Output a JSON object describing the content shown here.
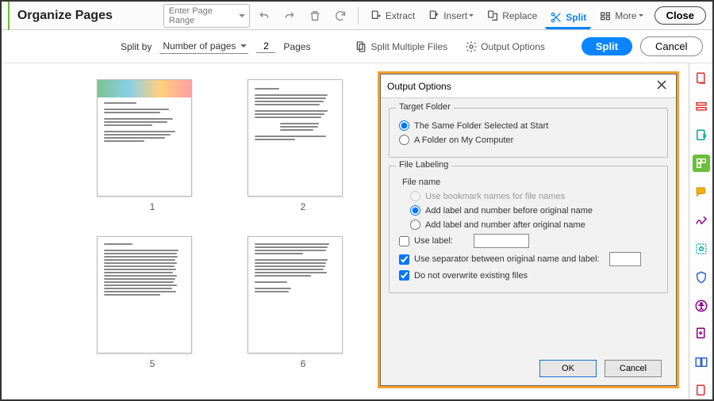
{
  "header": {
    "title": "Organize Pages",
    "page_range_placeholder": "Enter Page Range",
    "extract": "Extract",
    "insert": "Insert",
    "replace": "Replace",
    "split": "Split",
    "more": "More",
    "close": "Close"
  },
  "subheader": {
    "split_by": "Split by",
    "split_mode": "Number of pages",
    "split_value": "2",
    "pages_label": "Pages",
    "multi_files": "Split Multiple Files",
    "output_options": "Output Options",
    "split_btn": "Split",
    "cancel_btn": "Cancel"
  },
  "thumbnails": [
    "1",
    "2",
    "5",
    "6"
  ],
  "dialog": {
    "title": "Output Options",
    "target_folder_label": "Target Folder",
    "opt_same": "The Same Folder Selected at Start",
    "opt_myfolder": "A Folder on My Computer",
    "file_labeling": "File Labeling",
    "file_name": "File name",
    "opt_bookmark": "Use bookmark names for file names",
    "opt_before": "Add label and number before original name",
    "opt_after": "Add label and number after original name",
    "chk_uselabel": "Use label:",
    "chk_separator": "Use separator between original name and label:",
    "chk_overwrite": "Do not overwrite existing files",
    "ok": "OK",
    "cancel": "Cancel"
  },
  "sidebar_icons": [
    "export-pdf",
    "edit-pdf",
    "create-pdf",
    "organize-pages",
    "comment",
    "fill-sign",
    "sign",
    "protect",
    "more-tools",
    "accessibility",
    "add-tool",
    "compare"
  ]
}
